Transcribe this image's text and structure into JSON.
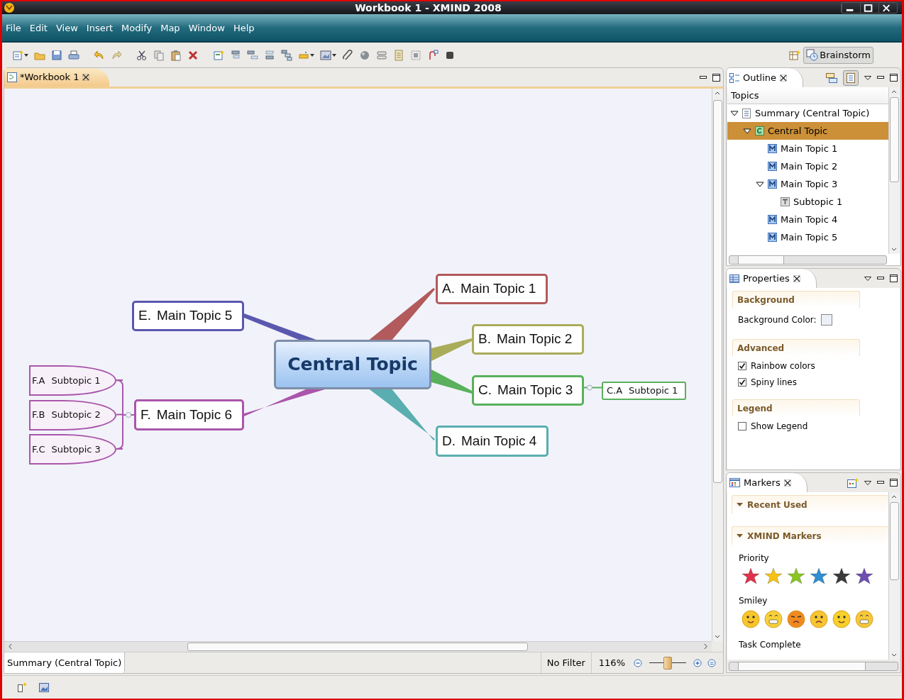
{
  "window": {
    "title": "Workbook 1 - XMIND 2008"
  },
  "menu": [
    "File",
    "Edit",
    "View",
    "Insert",
    "Modify",
    "Map",
    "Window",
    "Help"
  ],
  "toolbar": {
    "perspective_button": "Brainstorm"
  },
  "editor": {
    "tab": {
      "label": "*Workbook 1",
      "selected": true
    },
    "map": {
      "central": "Central Topic",
      "main_topics": [
        {
          "number": "A.",
          "title": "Main Topic 1",
          "color": "#b25a5c"
        },
        {
          "number": "B.",
          "title": "Main Topic 2",
          "color": "#a9ad5a"
        },
        {
          "number": "C.",
          "title": "Main Topic 3",
          "color": "#5ab05c",
          "subtopics": [
            {
              "number": "C.A",
              "title": "Subtopic 1"
            }
          ]
        },
        {
          "number": "D.",
          "title": "Main Topic 4",
          "color": "#5aaeb0"
        },
        {
          "number": "E.",
          "title": "Main Topic 5",
          "color": "#5a58ae"
        },
        {
          "number": "F.",
          "title": "Main Topic 6",
          "color": "#a956ab",
          "subtopics": [
            {
              "number": "F.A",
              "title": "Subtopic 1"
            },
            {
              "number": "F.B",
              "title": "Subtopic 2"
            },
            {
              "number": "F.C",
              "title": "Subtopic 3"
            }
          ]
        }
      ]
    },
    "status": {
      "selection": "Summary (Central Topic)",
      "filter": "No Filter",
      "zoom": "116%",
      "zoom_slider": {
        "level": 0.5
      }
    }
  },
  "outline": {
    "tab": "Outline",
    "column": "Topics",
    "tree": [
      {
        "label": "Summary (Central Topic)",
        "kind": "sheet",
        "expanded": true,
        "selected": false,
        "children": [
          {
            "label": "Central Topic",
            "kind": "central",
            "expanded": true,
            "selected": true,
            "children": [
              {
                "label": "Main Topic 1",
                "kind": "main",
                "expanded": false,
                "selected": false
              },
              {
                "label": "Main Topic 2",
                "kind": "main",
                "expanded": false,
                "selected": false
              },
              {
                "label": "Main Topic 3",
                "kind": "main",
                "expanded": true,
                "selected": false,
                "children": [
                  {
                    "label": "Subtopic 1",
                    "kind": "sub",
                    "expanded": false,
                    "selected": false
                  }
                ]
              },
              {
                "label": "Main Topic 4",
                "kind": "main",
                "expanded": false,
                "selected": false
              },
              {
                "label": "Main Topic 5",
                "kind": "main",
                "expanded": false,
                "selected": false
              }
            ]
          }
        ]
      }
    ]
  },
  "properties": {
    "tab": "Properties",
    "sections": [
      {
        "title": "Background",
        "items": [
          {
            "kind": "color",
            "label": "Background Color:"
          }
        ]
      },
      {
        "title": "Advanced",
        "items": [
          {
            "kind": "checkbox",
            "label": "Rainbow colors",
            "checked": true
          },
          {
            "kind": "checkbox",
            "label": "Spiny lines",
            "checked": true
          }
        ]
      },
      {
        "title": "Legend",
        "items": [
          {
            "kind": "checkbox",
            "label": "Show Legend",
            "checked": false
          }
        ]
      }
    ]
  },
  "markers": {
    "tab": "Markers",
    "sections": [
      {
        "title": "Recent Used",
        "expanded": true
      },
      {
        "title": "XMIND Markers",
        "expanded": true,
        "groups": [
          {
            "name": "Priority",
            "kind": "priority"
          },
          {
            "name": "Smiley",
            "kind": "smiley"
          },
          {
            "name": "Task Complete",
            "kind": "task"
          }
        ]
      }
    ]
  }
}
